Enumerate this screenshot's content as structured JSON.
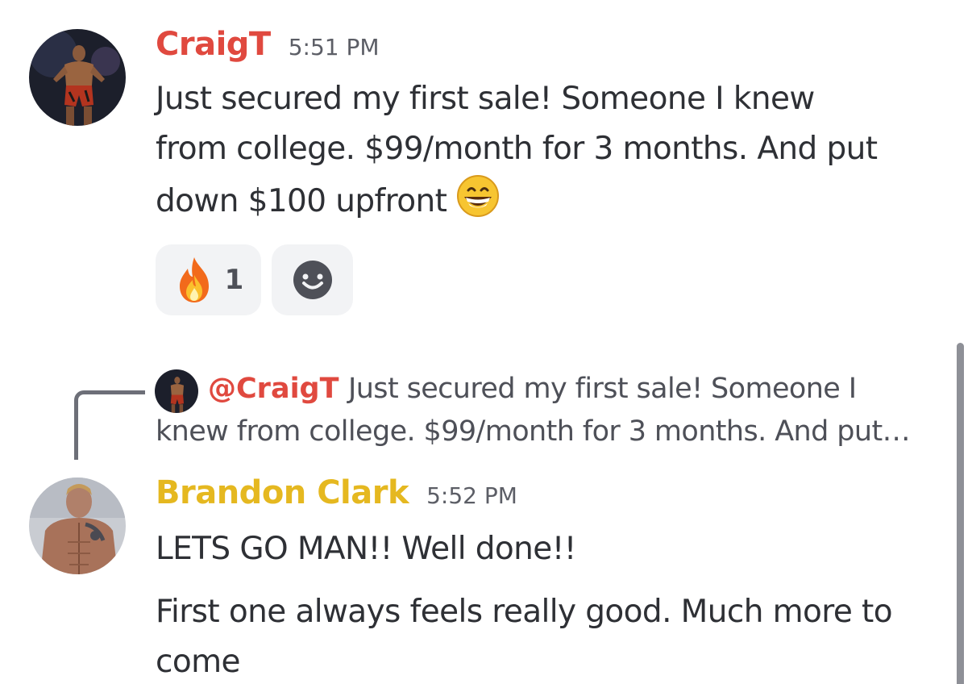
{
  "messages": [
    {
      "author": "CraigT",
      "time": "5:51 PM",
      "lines": [
        "Just secured my first sale! Someone I knew",
        "from college. $99/month for 3 months. And put",
        "down $100 upfront"
      ],
      "emoji": "grinning-face-with-smiling-eyes",
      "reactions": [
        {
          "emoji": "fire",
          "count": "1"
        }
      ],
      "add_reaction_icon": "add-reaction-smiley-icon"
    },
    {
      "author": "Brandon Clark",
      "time": "5:52 PM",
      "reply": {
        "mention": "@CraigT",
        "snippet_line1": "Just secured my first sale! Someone I",
        "snippet_line2": "knew from college. $99/month for 3 months. And put…"
      },
      "lines": [
        "LETS GO MAN!! Well done!!"
      ],
      "lines2": [
        "First one always feels really good. Much more to",
        "come"
      ]
    }
  ],
  "colors": {
    "craig_name": "#e0493f",
    "brandon_name": "#e5b820",
    "text": "#2e3035",
    "muted": "#5c5e66",
    "reaction_bg": "#f2f3f5"
  }
}
